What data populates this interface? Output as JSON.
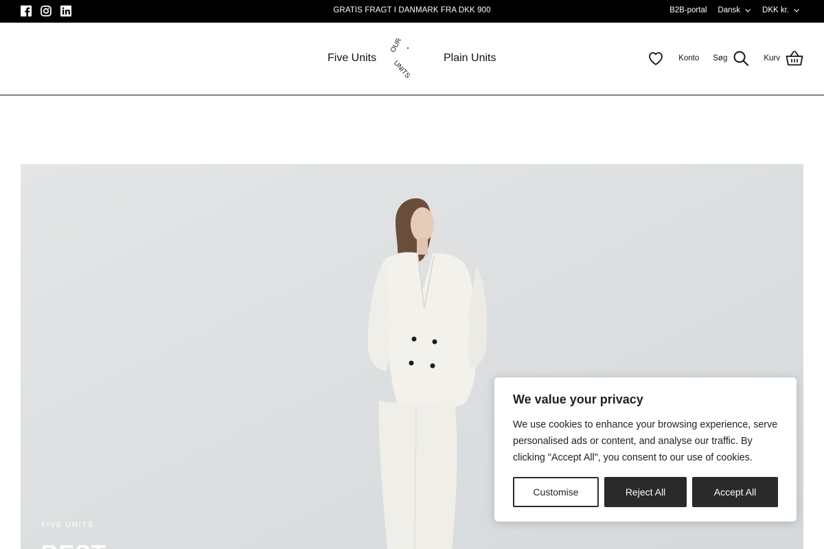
{
  "topbar": {
    "social": [
      {
        "name": "facebook-icon"
      },
      {
        "name": "instagram-icon"
      },
      {
        "name": "linkedin-icon"
      }
    ],
    "announcement": "GRATIS FRAGT I DANMARK FRA DKK 900",
    "b2b": "B2B-portal",
    "language": "Dansk",
    "currency": "DKK kr."
  },
  "header": {
    "nav_left": "Five Units",
    "nav_right": "Plain Units",
    "logo_top": "OUR",
    "logo_bottom": "UNITS",
    "account": "Konto",
    "search": "Søg",
    "cart": "Kurv"
  },
  "hero": {
    "eyebrow": "FIVE UNITS",
    "title": "BEST"
  },
  "cookie": {
    "title": "We value your privacy",
    "text": "We use cookies to enhance your browsing experience, serve personalised ads or content, and analyse our traffic. By clicking \"Accept All\", you consent to our use of cookies.",
    "customise": "Customise",
    "reject": "Reject All",
    "accept": "Accept All"
  },
  "colors": {
    "topbar_bg": "#000000",
    "button_dark": "#2a2a2a",
    "hero_bg": "#dde0e2"
  }
}
